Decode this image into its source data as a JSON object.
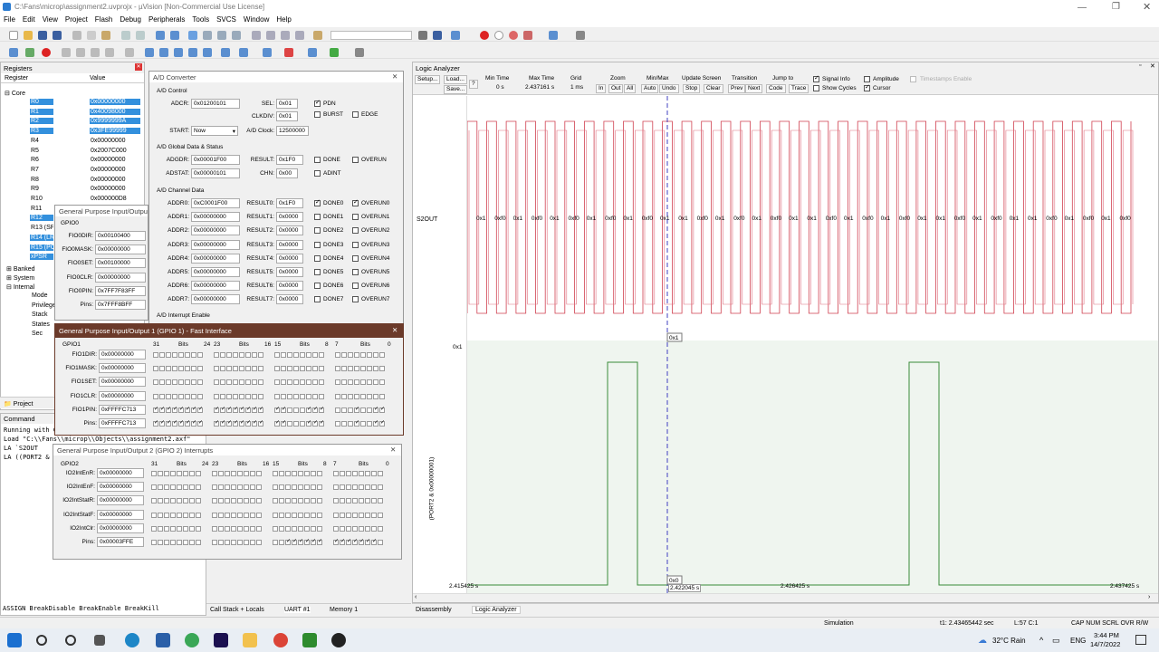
{
  "window": {
    "title": "C:\\Fans\\microp\\assignment2.uvprojx - µVision  [Non-Commercial Use License]"
  },
  "menu": [
    "File",
    "Edit",
    "View",
    "Project",
    "Flash",
    "Debug",
    "Peripherals",
    "Tools",
    "SVCS",
    "Window",
    "Help"
  ],
  "registers": {
    "title": "Registers",
    "col_register": "Register",
    "col_value": "Value",
    "groups": {
      "core": "Core",
      "banked": "Banked",
      "system": "System",
      "internal": "Internal"
    },
    "rows": [
      {
        "name": "R0",
        "value": "0x00000000",
        "selected": true
      },
      {
        "name": "R1",
        "value": "0x40098000",
        "selected": true
      },
      {
        "name": "R2",
        "value": "0x9999999A",
        "selected": true
      },
      {
        "name": "R3",
        "value": "0x3FE99999",
        "selected": true
      },
      {
        "name": "R4",
        "value": "0x00000000",
        "selected": false
      },
      {
        "name": "R5",
        "value": "0x2007C000",
        "selected": false
      },
      {
        "name": "R6",
        "value": "0x00000000",
        "selected": false
      },
      {
        "name": "R7",
        "value": "0x00000000",
        "selected": false
      },
      {
        "name": "R8",
        "value": "0x00000000",
        "selected": false
      },
      {
        "name": "R9",
        "value": "0x00000000",
        "selected": false
      },
      {
        "name": "R10",
        "value": "0x000000D8",
        "selected": false
      },
      {
        "name": "R11",
        "value": "",
        "selected": false
      },
      {
        "name": "R12",
        "value": "",
        "selected": true
      },
      {
        "name": "R13 (SP)",
        "value": "",
        "selected": false
      },
      {
        "name": "R14 (LR)",
        "value": "",
        "selected": true
      },
      {
        "name": "R15 (PC)",
        "value": "",
        "selected": true
      },
      {
        "name": "xPSR",
        "value": "",
        "selected": true
      }
    ],
    "internal_items": [
      "Mode",
      "Privilege",
      "Stack",
      "States",
      "Sec"
    ],
    "tabs": {
      "project": "Project"
    }
  },
  "command": {
    "title": "Command",
    "lines": [
      "Running with Code Size Limit: 32K",
      "Load \"C:\\\\Fans\\\\microp\\\\Objects\\\\assignment2.axf\"",
      "LA `S2OUT",
      "LA ((PORT2 & 0x00000001) >> 0 & 0x1)"
    ],
    "autocomplete": "ASSIGN BreakDisable BreakEnable BreakKill"
  },
  "adc": {
    "title": "A/D Converter",
    "control_label": "A/D Control",
    "adcr_label": "ADCR:",
    "adcr": "0x01200101",
    "sel_label": "SEL:",
    "sel": "0x01",
    "pdn": "PDN",
    "clkdiv_label": "CLKDIV:",
    "clkdiv": "0x01",
    "burst": "BURST",
    "edge": "EDGE",
    "start_label": "START:",
    "start": "Now",
    "aclock_label": "A/D Clock:",
    "aclock": "12500000",
    "global_label": "A/D Global Data & Status",
    "adgdr_label": "ADGDR:",
    "adgdr": "0x00001F00",
    "result_label": "RESULT:",
    "result": "0x1F0",
    "done": "DONE",
    "overun": "OVERUN",
    "adstat_label": "ADSTAT:",
    "adstat": "0x00000101",
    "chn_label": "CHN:",
    "chn": "0x00",
    "adint": "ADINT",
    "channel_label": "A/D Channel Data",
    "channels": [
      {
        "a": "ADDR0:",
        "av": "0xC0001F00",
        "r": "RESULT0:",
        "rv": "0x1F0",
        "d": "DONE0",
        "o": "OVERUN0",
        "on": true
      },
      {
        "a": "ADDR1:",
        "av": "0x00000000",
        "r": "RESULT1:",
        "rv": "0x0000",
        "d": "DONE1",
        "o": "OVERUN1",
        "on": false
      },
      {
        "a": "ADDR2:",
        "av": "0x00000000",
        "r": "RESULT2:",
        "rv": "0x0000",
        "d": "DONE2",
        "o": "OVERUN2",
        "on": false
      },
      {
        "a": "ADDR3:",
        "av": "0x00000000",
        "r": "RESULT3:",
        "rv": "0x0000",
        "d": "DONE3",
        "o": "OVERUN3",
        "on": false
      },
      {
        "a": "ADDR4:",
        "av": "0x00000000",
        "r": "RESULT4:",
        "rv": "0x0000",
        "d": "DONE4",
        "o": "OVERUN4",
        "on": false
      },
      {
        "a": "ADDR5:",
        "av": "0x00000000",
        "r": "RESULT5:",
        "rv": "0x0000",
        "d": "DONE5",
        "o": "OVERUN5",
        "on": false
      },
      {
        "a": "ADDR6:",
        "av": "0x00000000",
        "r": "RESULT6:",
        "rv": "0x0000",
        "d": "DONE6",
        "o": "OVERUN6",
        "on": false
      },
      {
        "a": "ADDR7:",
        "av": "0x00000000",
        "r": "RESULT7:",
        "rv": "0x0000",
        "d": "DONE7",
        "o": "OVERUN7",
        "on": false
      }
    ],
    "interrupt_label": "A/D Interrupt Enable"
  },
  "gpio0": {
    "title": "General Purpose Input/Output 0 (GPIO 0) - Fast Interface",
    "group": "GPIO0",
    "rows": [
      {
        "l": "FIO0DIR:",
        "v": "0x00100400"
      },
      {
        "l": "FIO0MASK:",
        "v": "0x00000000"
      },
      {
        "l": "FIO0SET:",
        "v": "0x00100000"
      },
      {
        "l": "FIO0CLR:",
        "v": "0x00000000"
      },
      {
        "l": "FIO0PIN:",
        "v": "0x7FF7F83FF"
      },
      {
        "l": "Pins:",
        "v": "0x7FFF8BFF"
      }
    ]
  },
  "gpio1": {
    "title": "General Purpose Input/Output 1 (GPIO 1) - Fast Interface",
    "group": "GPIO1",
    "bits_header": [
      "31",
      "Bits",
      "24",
      "23",
      "Bits",
      "16",
      "15",
      "Bits",
      "8",
      "7",
      "Bits",
      "0"
    ],
    "rows": [
      {
        "l": "FIO1DIR:",
        "v": "0x00000000"
      },
      {
        "l": "FIO1MASK:",
        "v": "0x00000000"
      },
      {
        "l": "FIO1SET:",
        "v": "0x00000000"
      },
      {
        "l": "FIO1CLR:",
        "v": "0x00000000"
      },
      {
        "l": "FIO1PIN:",
        "v": "0xFFFFC713"
      },
      {
        "l": "Pins:",
        "v": "0xFFFFC713"
      }
    ]
  },
  "gpio2": {
    "title": "General Purpose Input/Output 2 (GPIO 2) Interrupts",
    "group": "GPIO2",
    "bits_header": [
      "31",
      "Bits",
      "24",
      "23",
      "Bits",
      "16",
      "15",
      "Bits",
      "8",
      "7",
      "Bits",
      "0"
    ],
    "rows": [
      {
        "l": "IO2IntEnR:",
        "v": "0x00000000"
      },
      {
        "l": "IO2IntEnF:",
        "v": "0x00000000"
      },
      {
        "l": "IO2IntStatR:",
        "v": "0x00000000"
      },
      {
        "l": "IO2IntStatF:",
        "v": "0x00000000"
      },
      {
        "l": "IO2IntClr:",
        "v": "0x00000000"
      },
      {
        "l": "Pins:",
        "v": "0x00003FFE"
      }
    ]
  },
  "la": {
    "title": "Logic Analyzer",
    "setup": "Setup...",
    "load": "Load...",
    "save": "Save...",
    "help": "?",
    "min_time_label": "Min Time",
    "min_time": "0 s",
    "max_time_label": "Max Time",
    "max_time": "2.437161 s",
    "grid_label": "Grid",
    "grid": "1 ms",
    "zoom_label": "Zoom",
    "zoom_in": "In",
    "zoom_out": "Out",
    "zoom_all": "All",
    "minmax_label": "Min/Max",
    "auto": "Auto",
    "undo": "Undo",
    "update_label": "Update Screen",
    "stop": "Stop",
    "clear": "Clear",
    "transition_label": "Transition",
    "prev": "Prev",
    "next": "Next",
    "jump_label": "Jump to",
    "code": "Code",
    "trace": "Trace",
    "signal_info": "Signal Info",
    "show_cycles": "Show Cycles",
    "amplitude": "Amplitude",
    "cursor": "Cursor",
    "timestamps": "Timestamps Enable",
    "signal1": "S2OUT",
    "signal2": "(PORT2 & 0x00000001)",
    "s2out_labels": [
      "0x1",
      "0xf0",
      "0x1",
      "0xf0",
      "0x1",
      "0xf0",
      "0x1",
      "0xf0",
      "0x1",
      "0xf0",
      "0x1",
      "0x1",
      "0xf0",
      "0x1",
      "0xf0",
      "0x1",
      "0xf0",
      "0x1",
      "0x1",
      "0xf0",
      "0x1",
      "0xf0",
      "0x1",
      "0xf0",
      "0x1",
      "0x1",
      "0xf0",
      "0x1",
      "0xf0",
      "0x1",
      "0x1",
      "0xf0",
      "0x1",
      "0xf0",
      "0x1",
      "0xf0"
    ],
    "axis_high": "0x1",
    "axis_low": "0x0",
    "cursor_top": "0x1",
    "cursor_bottom": "0x0",
    "t_left": "2.415425 s",
    "t_cursor": "2.422045 s",
    "t_mid": "2.426425 s",
    "t_right": "2.437425 s"
  },
  "bottom_tabs": {
    "callstack": "Call Stack + Locals",
    "uart": "UART #1",
    "memory": "Memory 1",
    "disassembly": "Disassembly",
    "logic": "Logic Analyzer"
  },
  "status": {
    "mode": "Simulation",
    "time": "t1: 2.43465442 sec",
    "pos": "L:57 C:1",
    "caps": "CAP  NUM  SCRL  OVR  R/W"
  },
  "taskbar": {
    "weather": "32°C  Rain",
    "lang": "ENG",
    "time": "3:44 PM",
    "date": "14/7/2022"
  }
}
